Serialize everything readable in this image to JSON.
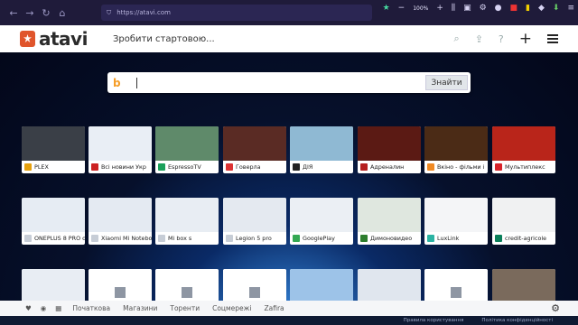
{
  "browser": {
    "url": "https://atavi.com",
    "zoom": "100%"
  },
  "header": {
    "logo_text": "atavi",
    "start_link": "Зробити стартовою..."
  },
  "search": {
    "button_label": "Знайти"
  },
  "tiles_row1": [
    {
      "label": "PLEX",
      "fav": "#e5a00d",
      "thumb": "#3a3f47"
    },
    {
      "label": "Всі новини Укр",
      "fav": "#c22",
      "thumb": "#e9eef5"
    },
    {
      "label": "EspressoTV",
      "fav": "#1aa05a",
      "thumb": "#5f8a6a"
    },
    {
      "label": "Говерла",
      "fav": "#d33",
      "thumb": "#5a2b24"
    },
    {
      "label": "ДІЯ",
      "fav": "#222",
      "thumb": "#8fb9d3"
    },
    {
      "label": "Адреналин",
      "fav": "#b51f1f",
      "thumb": "#5b1a14"
    },
    {
      "label": "Вкіно - фільми і",
      "fav": "#f08a24",
      "thumb": "#4b2b16"
    },
    {
      "label": "Мультиплекс",
      "fav": "#d8232a",
      "thumb": "#b9251a"
    }
  ],
  "tiles_row2": [
    {
      "label": "ONEPLUS 8 PRO об",
      "fav": "#c7cdd6",
      "thumb": "#e6ecf3"
    },
    {
      "label": "Xiaomi Mi Notebook",
      "fav": "#c7cdd6",
      "thumb": "#e4eaf2"
    },
    {
      "label": "Mi box s",
      "fav": "#c7cdd6",
      "thumb": "#e8edf3"
    },
    {
      "label": "Legion 5 pro",
      "fav": "#c7cdd6",
      "thumb": "#e4e9f0"
    },
    {
      "label": "GooglePlay",
      "fav": "#34a853",
      "thumb": "#ebeff4"
    },
    {
      "label": "Димоновидео",
      "fav": "#2d7d2d",
      "thumb": "#dfe7df"
    },
    {
      "label": "LuxLink",
      "fav": "#2bb3a3",
      "thumb": "#f4f5f7"
    },
    {
      "label": "credit-agricole",
      "fav": "#0a7f5a",
      "thumb": "#f0f1f2"
    }
  ],
  "tiles_row3": [
    {
      "label": "",
      "thumb": "#e8edf3",
      "placeholder": false
    },
    {
      "label": "",
      "thumb": "",
      "placeholder": true
    },
    {
      "label": "",
      "thumb": "",
      "placeholder": true
    },
    {
      "label": "",
      "thumb": "",
      "placeholder": true
    },
    {
      "label": "",
      "thumb": "#9dc3e8",
      "placeholder": false
    },
    {
      "label": "",
      "thumb": "#e0e6ee",
      "placeholder": false
    },
    {
      "label": "",
      "thumb": "",
      "placeholder": true
    },
    {
      "label": "",
      "thumb": "#7a6a5c",
      "placeholder": false
    }
  ],
  "bottom": {
    "tabs": [
      "Початкова",
      "Магазини",
      "Торенти",
      "Соцмережі",
      "Zafira"
    ],
    "active": "Початкова"
  },
  "status": {
    "terms": "Правила користування",
    "privacy": "Політика конфіденційності"
  }
}
